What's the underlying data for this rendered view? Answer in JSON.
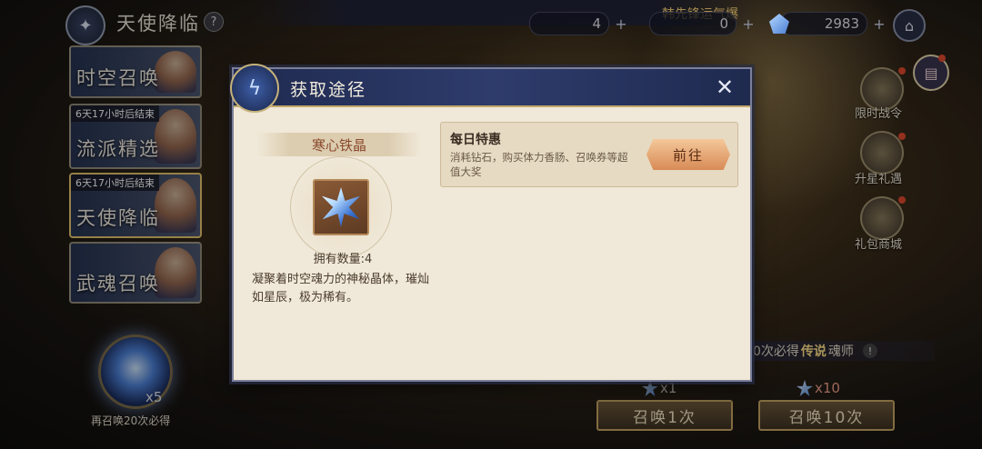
{
  "header": {
    "title": "天使降临",
    "help_icon": "question-icon",
    "marquee": "韩先锋运气爆",
    "currency": [
      {
        "icon": "silver-token-icon",
        "value": "4"
      },
      {
        "icon": "gold-token-icon",
        "value": "0"
      },
      {
        "icon": "diamond-icon",
        "value": "2983"
      }
    ],
    "home_icon": "home-icon"
  },
  "banners": [
    {
      "name": "时空召唤",
      "timer": ""
    },
    {
      "name": "流派精选",
      "timer": "6天17小时后结束"
    },
    {
      "name": "天使降临",
      "timer": "6天17小时后结束"
    },
    {
      "name": "武魂召唤",
      "timer": ""
    }
  ],
  "summon_orb": {
    "count": "x5",
    "note": "再召唤20次必得"
  },
  "side_menu": [
    {
      "label": "限时战令"
    },
    {
      "label": "升星礼遇"
    },
    {
      "label": "礼包商城"
    }
  ],
  "guarantee": {
    "prefix": "0次必得",
    "highlight": "传说",
    "suffix": "魂师",
    "info": "!"
  },
  "summon_buttons": [
    {
      "label": "召唤1次",
      "cost": "x1"
    },
    {
      "label": "召唤10次",
      "cost": "x10"
    }
  ],
  "modal": {
    "title": "获取途径",
    "item": {
      "name": "寒心铁晶",
      "owned": "拥有数量:4",
      "description": "凝聚着时空魂力的神秘晶体，璀灿如星辰，极为稀有。"
    },
    "sources": [
      {
        "title": "每日特惠",
        "description": "消耗钻石，购买体力香肠、召唤券等超值大奖",
        "button": "前往"
      }
    ]
  },
  "colors": {
    "modal_header": "#1f2a4f",
    "modal_body": "#f0e8d8",
    "go_button": "#d88b56",
    "item_name": "#8b4a2e",
    "highlight": "#ffe08a"
  }
}
